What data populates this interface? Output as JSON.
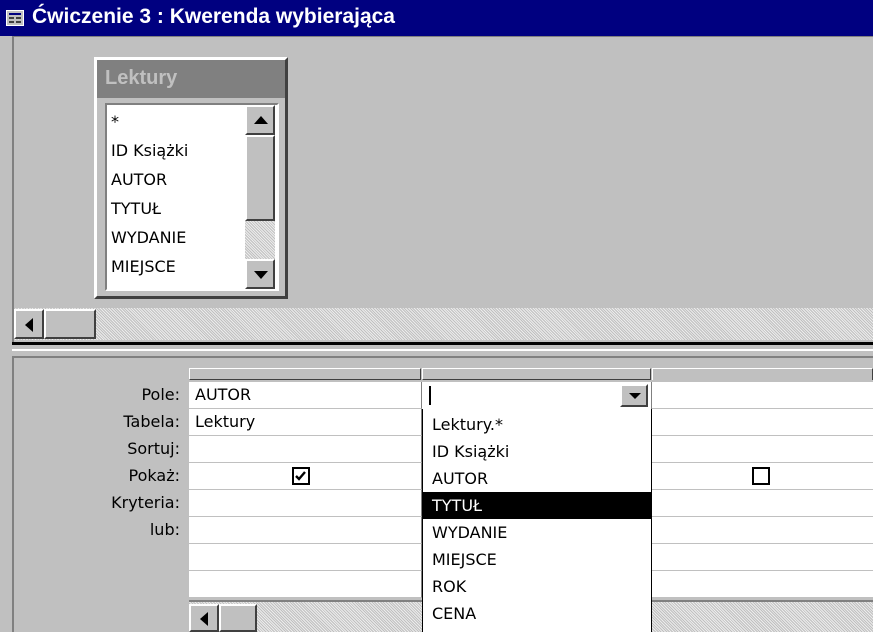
{
  "window": {
    "title": "Ćwiczenie 3 : Kwerenda wybierająca"
  },
  "table_box": {
    "name": "Lektury",
    "fields": [
      "*",
      "ID Książki",
      "AUTOR",
      "TYTUŁ",
      "WYDANIE",
      "MIEJSCE"
    ]
  },
  "grid": {
    "row_labels": [
      "Pole:",
      "Tabela:",
      "Sortuj:",
      "Pokaż:",
      "Kryteria:",
      "lub:"
    ],
    "columns": [
      {
        "field": "AUTOR",
        "table": "Lektury",
        "show": true
      },
      {
        "field": "",
        "table": "",
        "show": null
      },
      {
        "field": "",
        "table": "",
        "show": false
      }
    ]
  },
  "dropdown": {
    "options": [
      "Lektury.*",
      "ID Książki",
      "AUTOR",
      "TYTUŁ",
      "WYDANIE",
      "MIEJSCE",
      "ROK",
      "CENA"
    ],
    "highlighted": "TYTUŁ"
  },
  "colors": {
    "titlebar": "#000080",
    "highlight": "#000000"
  }
}
